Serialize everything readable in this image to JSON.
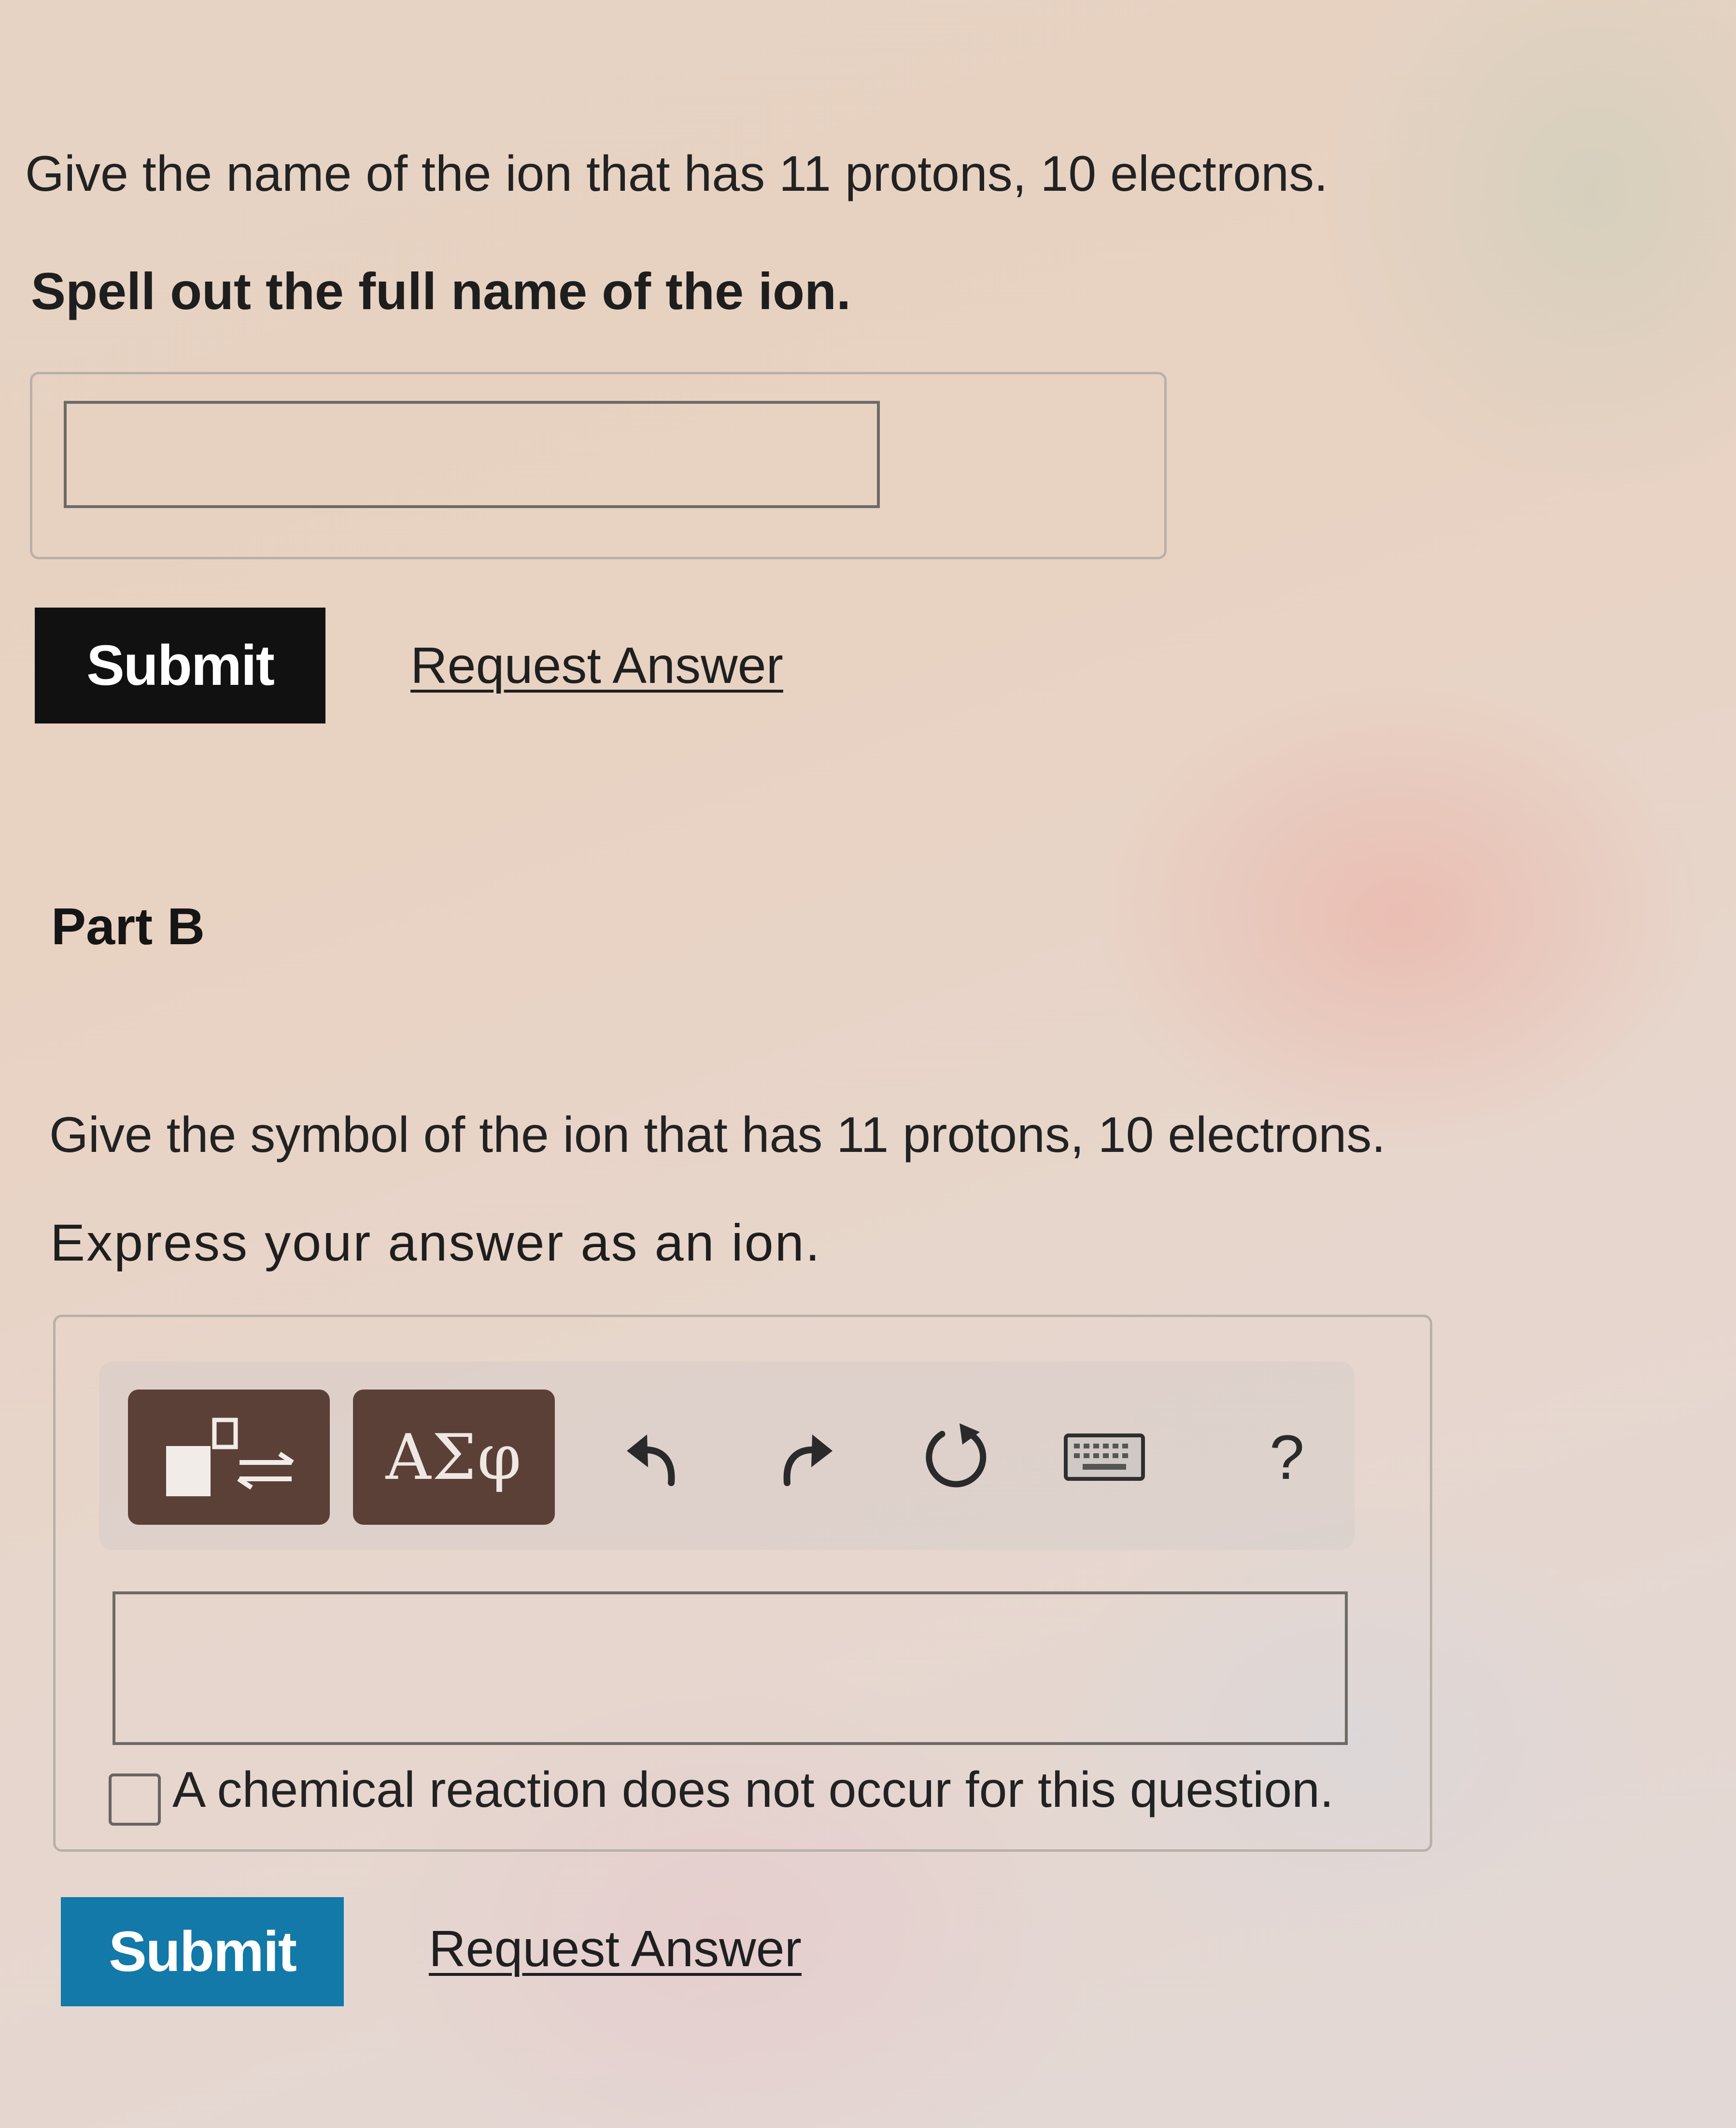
{
  "colors": {
    "submit_a_bg": "#111111",
    "submit_b_bg": "#1279a8",
    "tool_button_bg": "#5b4038",
    "link_color": "#1f1f1f"
  },
  "part_a": {
    "question": "Give the name of the ion that has 11 protons, 10 electrons.",
    "instruction": "Spell out the full name of the ion.",
    "answer_value": "",
    "submit_label": "Submit",
    "request_answer_label": "Request Answer"
  },
  "part_b": {
    "title": "Part B",
    "question": "Give the symbol of the ion that has 11 protons, 10 electrons.",
    "instruction": "Express your answer as an ion.",
    "toolbar": {
      "items": [
        {
          "icon": "templates-icon"
        },
        {
          "icon": "greek-letters-icon",
          "label": "ΑΣφ"
        },
        {
          "icon": "undo-icon"
        },
        {
          "icon": "redo-icon"
        },
        {
          "icon": "reset-icon"
        },
        {
          "icon": "keyboard-icon"
        },
        {
          "icon": "help-icon",
          "label": "?"
        }
      ]
    },
    "answer_value": "",
    "checkbox_label": "A chemical reaction does not occur for this question.",
    "checkbox_checked": false,
    "submit_label": "Submit",
    "request_answer_label": "Request Answer"
  }
}
